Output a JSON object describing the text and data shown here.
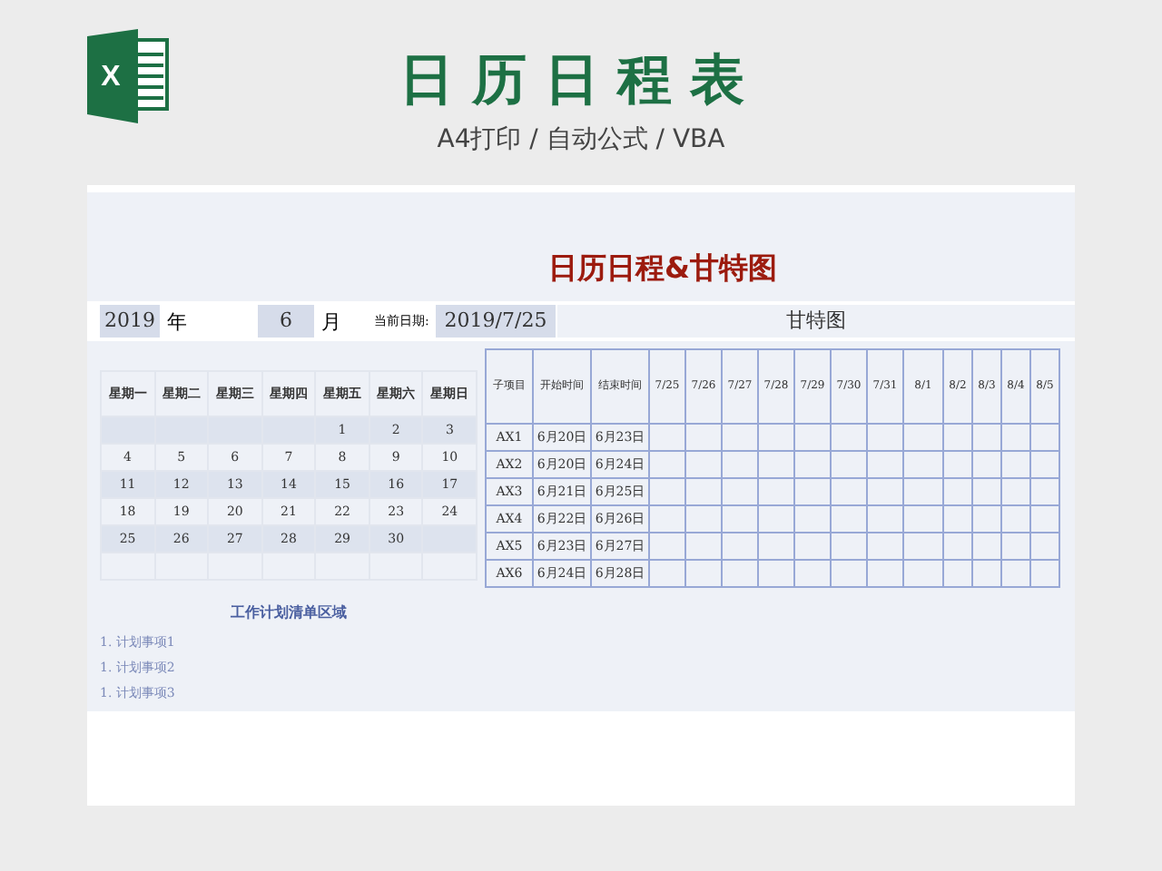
{
  "header": {
    "logo_letter": "X",
    "title": "日历日程表",
    "subtitle": "A4打印 / 自动公式 / VBA"
  },
  "sheet": {
    "banner": "日历日程&甘特图",
    "year": "2019",
    "year_label": "年",
    "month": "6",
    "month_label": "月",
    "today_label": "当前日期:",
    "today": "2019/7/25",
    "calendar": {
      "weekdays": [
        "星期一",
        "星期二",
        "星期三",
        "星期四",
        "星期五",
        "星期六",
        "星期日"
      ],
      "weeks": [
        [
          {
            "kind": "blank"
          },
          {
            "kind": "blank"
          },
          {
            "kind": "blank"
          },
          {
            "kind": "blank"
          },
          {
            "kind": "day",
            "day": "1"
          },
          {
            "kind": "day",
            "day": "2"
          },
          {
            "kind": "day",
            "day": "3"
          }
        ],
        [
          {
            "kind": "day",
            "day": "4"
          },
          {
            "kind": "day",
            "day": "5"
          },
          {
            "kind": "day",
            "day": "6"
          },
          {
            "kind": "day",
            "day": "7"
          },
          {
            "kind": "day",
            "day": "8"
          },
          {
            "kind": "day",
            "day": "9"
          },
          {
            "kind": "day",
            "day": "10"
          }
        ],
        [
          {
            "kind": "day",
            "day": "11"
          },
          {
            "kind": "day",
            "day": "12"
          },
          {
            "kind": "day",
            "day": "13"
          },
          {
            "kind": "day",
            "day": "14"
          },
          {
            "kind": "day",
            "day": "15"
          },
          {
            "kind": "day",
            "day": "16"
          },
          {
            "kind": "day",
            "day": "17"
          }
        ],
        [
          {
            "kind": "day",
            "day": "18"
          },
          {
            "kind": "day",
            "day": "19"
          },
          {
            "kind": "day",
            "day": "20"
          },
          {
            "kind": "day",
            "day": "21"
          },
          {
            "kind": "day",
            "day": "22"
          },
          {
            "kind": "day",
            "day": "23"
          },
          {
            "kind": "day",
            "day": "24"
          }
        ],
        [
          {
            "kind": "day",
            "day": "25"
          },
          {
            "kind": "day",
            "day": "26"
          },
          {
            "kind": "day",
            "day": "27"
          },
          {
            "kind": "day",
            "day": "28"
          },
          {
            "kind": "day",
            "day": "29"
          },
          {
            "kind": "day",
            "day": "30"
          },
          {
            "kind": "blank"
          }
        ]
      ]
    },
    "gantt": {
      "title": "甘特图",
      "columns": [
        "子项目",
        "开始时间",
        "结束时间",
        "7/25",
        "7/26",
        "7/27",
        "7/28",
        "7/29",
        "7/30",
        "7/31",
        "8/1",
        "8/2",
        "8/3",
        "8/4",
        "8/5"
      ],
      "rows": [
        {
          "item": "AX1",
          "start": "6月20日",
          "end": "6月23日"
        },
        {
          "item": "AX2",
          "start": "6月20日",
          "end": "6月24日"
        },
        {
          "item": "AX3",
          "start": "6月21日",
          "end": "6月25日"
        },
        {
          "item": "AX4",
          "start": "6月22日",
          "end": "6月26日"
        },
        {
          "item": "AX5",
          "start": "6月23日",
          "end": "6月27日"
        },
        {
          "item": "AX6",
          "start": "6月24日",
          "end": "6月28日"
        }
      ]
    },
    "plan": {
      "title": "工作计划清单区域",
      "items": [
        "1. 计划事项1",
        "1. 计划事项2",
        "1. 计划事项3"
      ]
    }
  }
}
